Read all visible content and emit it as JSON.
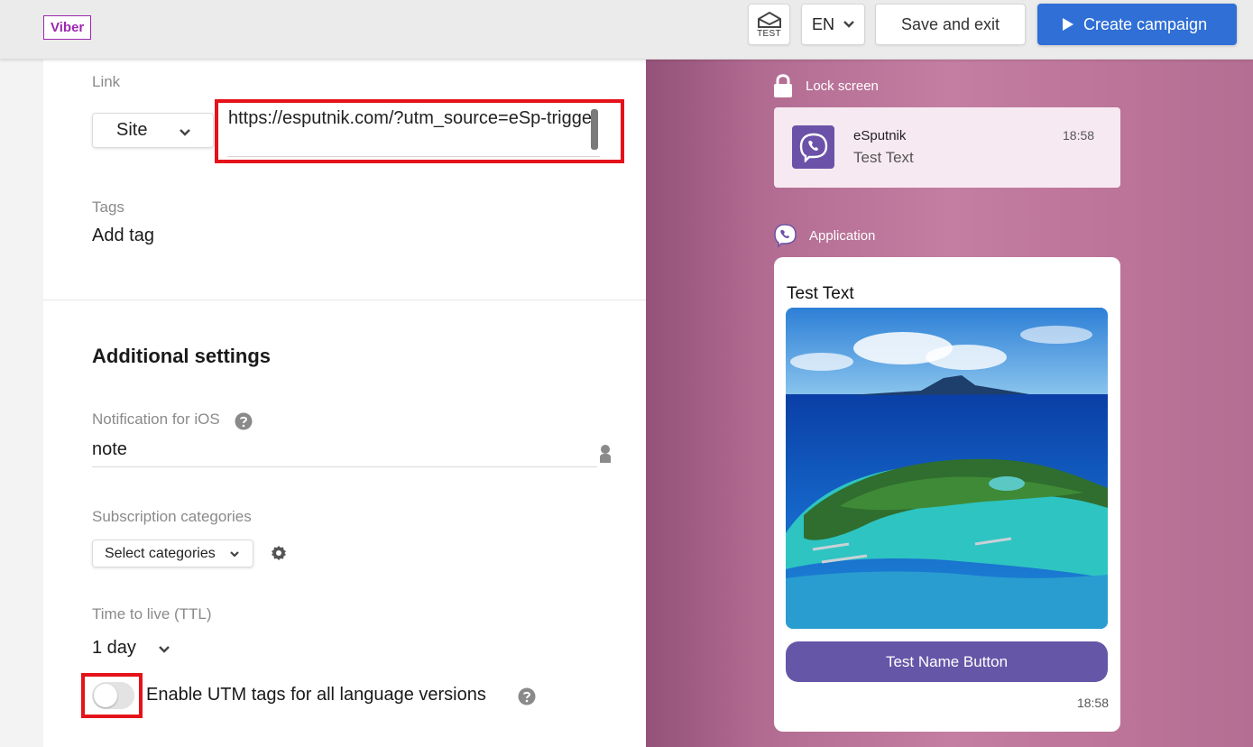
{
  "header": {
    "channel_badge": "Viber",
    "test_label": "TEST",
    "language": "EN",
    "save_exit": "Save and exit",
    "create_campaign": "Create campaign",
    "accent_color": "#2f6fd6"
  },
  "form": {
    "link_label": "Link",
    "link_type": "Site",
    "link_value": "https://esputnik.com/?utm_source=eSp-trigger",
    "tags_label": "Tags",
    "add_tag": "Add tag",
    "additional_title": "Additional settings",
    "ios_label": "Notification for iOS",
    "ios_value": "note",
    "subs_label": "Subscription categories",
    "subs_placeholder": "Select categories",
    "ttl_label": "Time to live (TTL)",
    "ttl_value": "1 day",
    "utm_toggle_label": "Enable UTM tags for all language versions",
    "utm_enabled": false,
    "highlight_color": "#e5121a"
  },
  "preview": {
    "lock_label": "Lock screen",
    "lock_sender": "eSputnik",
    "lock_body": "Test Text",
    "lock_time": "18:58",
    "app_label": "Application",
    "message_text": "Test Text",
    "button_label": "Test Name Button",
    "message_time": "18:58",
    "brand_color": "#6656a8"
  }
}
